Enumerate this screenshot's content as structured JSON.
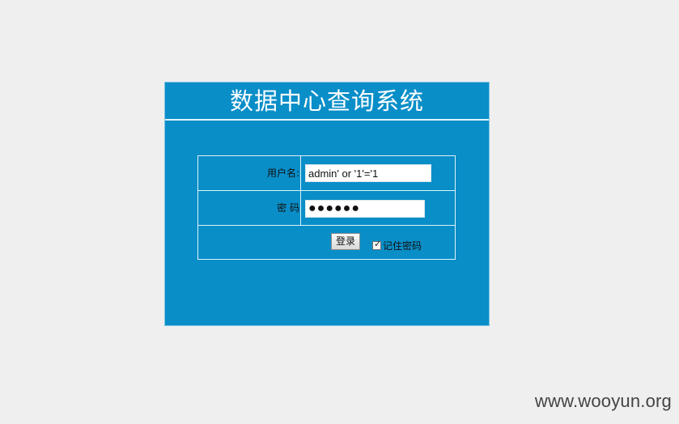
{
  "title": "数据中心查询系统",
  "form": {
    "username_label": "用户名:",
    "username_value": "admin' or '1'='1",
    "password_label": "密  码",
    "password_value": "●●●●●●",
    "login_button": "登录",
    "remember_label": "记住密码",
    "remember_checked": true
  },
  "watermark": "www.wooyun.org",
  "colors": {
    "page_background": "#efefef",
    "panel_background": "#098ec8",
    "panel_border": "#7fc6e6",
    "title_text": "#ffffff"
  }
}
